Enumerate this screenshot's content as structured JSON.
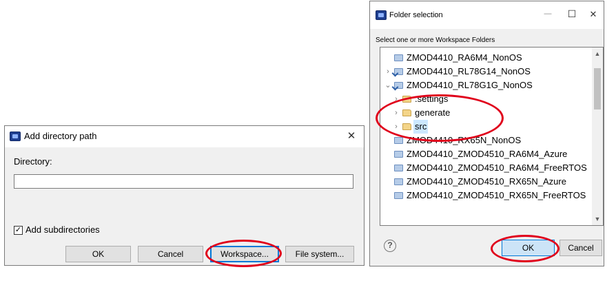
{
  "add_dialog": {
    "title": "Add directory path",
    "close_glyph": "✕",
    "directory_label": "Directory:",
    "directory_value": "",
    "subdirs_label": "Add subdirectories",
    "subdirs_checked": true,
    "check_glyph": "✓",
    "ok_label": "OK",
    "cancel_label": "Cancel",
    "workspace_label": "Workspace...",
    "filesystem_label": "File system..."
  },
  "folder_dialog": {
    "title": "Folder selection",
    "minimize_glyph": "—",
    "maximize_glyph": "☐",
    "close_glyph": "✕",
    "instruction": "Select one or more Workspace Folders",
    "tree": [
      {
        "label": "ZMOD4410_RA6M4_NonOS",
        "chevron": "",
        "icon": "project"
      },
      {
        "label": "ZMOD4410_RL78G14_NonOS",
        "chevron": "›",
        "icon": "project-shared"
      },
      {
        "label": "ZMOD4410_RL78G1G_NonOS",
        "chevron": "⌄",
        "icon": "project-shared"
      },
      {
        "label": ".settings",
        "chevron": "›",
        "icon": "folder"
      },
      {
        "label": "generate",
        "chevron": "›",
        "icon": "folder"
      },
      {
        "label": "src",
        "chevron": "›",
        "icon": "folder",
        "selected": true
      },
      {
        "label": "ZMOD4410_RX65N_NonOS",
        "chevron": "",
        "icon": "project"
      },
      {
        "label": "ZMOD4410_ZMOD4510_RA6M4_Azure",
        "chevron": "",
        "icon": "project"
      },
      {
        "label": "ZMOD4410_ZMOD4510_RA6M4_FreeRTOS",
        "chevron": "",
        "icon": "project"
      },
      {
        "label": "ZMOD4410_ZMOD4510_RX65N_Azure",
        "chevron": "",
        "icon": "project"
      },
      {
        "label": "ZMOD4410_ZMOD4510_RX65N_FreeRTOS",
        "chevron": "",
        "icon": "project"
      }
    ],
    "scroll_up_glyph": "▲",
    "scroll_down_glyph": "▼",
    "help_glyph": "?",
    "ok_label": "OK",
    "cancel_label": "Cancel"
  },
  "colors": {
    "highlight_ellipse": "#e0001b",
    "selection": "#cce8ff",
    "focus_border": "#0078d7"
  }
}
